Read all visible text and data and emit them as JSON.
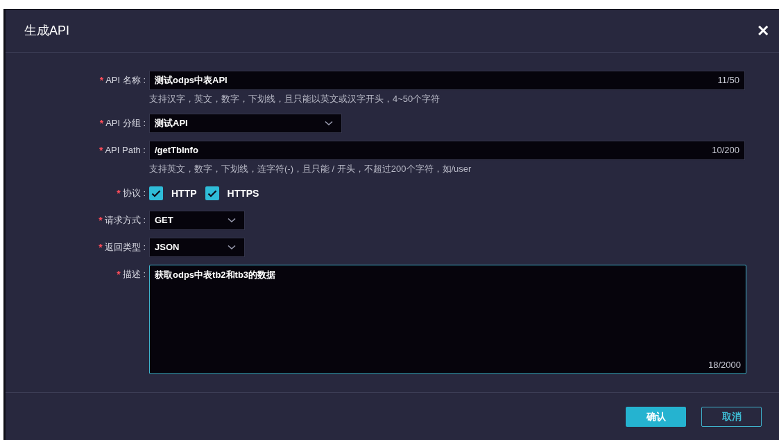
{
  "dialog": {
    "title": "生成API",
    "close": "✕"
  },
  "fields": [
    {
      "kind": "text",
      "mark": "*",
      "label": "API 名称 :",
      "value": "测试odps中表API",
      "counter": "11/50",
      "hint": "支持汉字，英文，数字，下划线，且只能以英文或汉字开头，4~50个字符"
    },
    {
      "kind": "select",
      "mark": "*",
      "label": "API 分组 :",
      "value": "测试API"
    },
    {
      "kind": "text",
      "mark": "*",
      "label": "API Path :",
      "value": "/getTbInfo",
      "counter": "10/200",
      "hint": "支持英文，数字，下划线，连字符(-)，且只能 / 开头，不超过200个字符，如/user"
    },
    {
      "kind": "checkboxes",
      "mark": "*",
      "label": "协议 :",
      "options": [
        {
          "label": "HTTP",
          "checked": true
        },
        {
          "label": "HTTPS",
          "checked": true
        }
      ]
    },
    {
      "kind": "select",
      "mark": "*",
      "label": "请求方式 :",
      "value": "GET"
    },
    {
      "kind": "select",
      "mark": "*",
      "label": "返回类型 :",
      "value": "JSON"
    },
    {
      "kind": "textarea",
      "mark": "*",
      "label": "描述 :",
      "value": "获取odps中表tb2和tb3的数据",
      "counter": "18/2000"
    }
  ],
  "buttons": [
    {
      "kind": "primary",
      "label": "确认"
    },
    {
      "kind": "secondary",
      "label": "取消"
    }
  ]
}
